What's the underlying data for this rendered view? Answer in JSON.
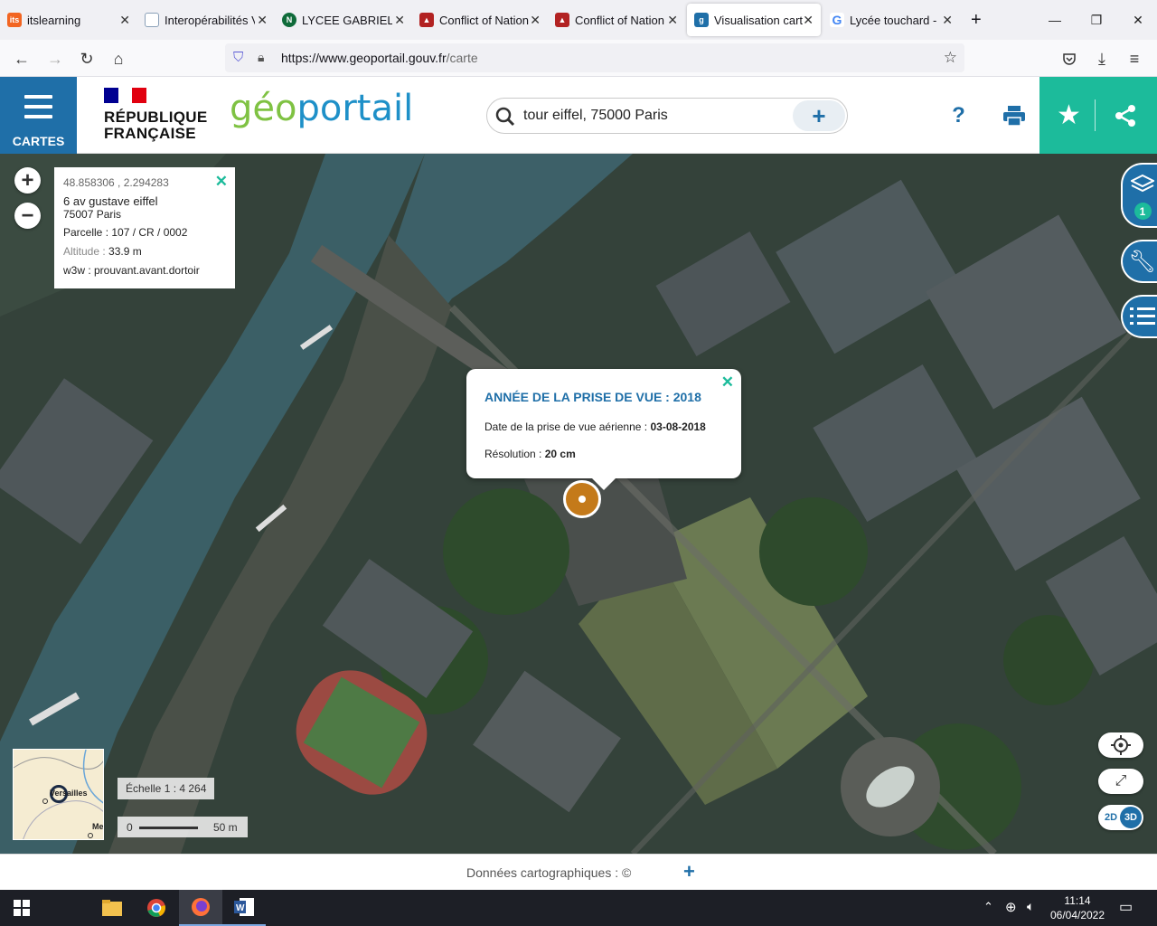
{
  "browser": {
    "tabs": [
      {
        "title": "itslearning",
        "favicon": "itslearning-favicon",
        "color": "#f26522"
      },
      {
        "title": "Interopérabilités V",
        "favicon": "document-favicon",
        "color": "#8aa0b8"
      },
      {
        "title": "LYCEE GABRIEL TC",
        "favicon": "ngt-favicon",
        "color": "#0f6b3a"
      },
      {
        "title": "Conflict of Nation",
        "favicon": "conflict-favicon",
        "color": "#b22222"
      },
      {
        "title": "Conflict of Nation",
        "favicon": "conflict-favicon",
        "color": "#b22222"
      },
      {
        "title": "Visualisation carte",
        "favicon": "geoportail-favicon",
        "color": "#1f6fa8"
      },
      {
        "title": "Lycée touchard - F",
        "favicon": "google-favicon",
        "color": "#4285f4"
      }
    ],
    "new_tab": "+",
    "url_main": "https://www.geoportail.gouv.fr",
    "url_path": "/carte"
  },
  "header": {
    "menu_label": "CARTES",
    "republique_line1": "RÉPUBLIQUE",
    "republique_line2": "FRANÇAISE",
    "logo_geo": "géo",
    "logo_portail": "portail",
    "search_value": "tour eiffel, 75000 Paris",
    "search_plus": "+",
    "help_label": "?"
  },
  "colors": {
    "brand_blue": "#1f6fa8",
    "accent_green": "#1cbb9b",
    "marker_orange": "#c47a1a"
  },
  "infobox": {
    "coords": "48.858306 , 2.294283",
    "address1": "6 av gustave eiffel",
    "address2": "75007 Paris",
    "parcelle": "Parcelle : 107 / CR / 0002",
    "altitude_label": "Altitude :",
    "altitude_value": "33.9 m",
    "w3w": "w3w : prouvant.avant.dortoir"
  },
  "popup": {
    "title": "ANNÉE DE LA PRISE DE VUE : 2018",
    "date_label": "Date de la prise de vue aérienne :",
    "date_value": "03-08-2018",
    "resolution_label": "Résolution :",
    "resolution_value": "20 cm"
  },
  "map": {
    "layers_count": "1",
    "view_2d": "2D",
    "view_3d": "3D",
    "scale_text": "Échelle 1 : 4 264",
    "scale_start": "0",
    "scale_end": "50 m",
    "minimap_label": "Versailles",
    "minimap_label2": "Me"
  },
  "footer": {
    "credits": "Données cartographiques : ©",
    "plus": "+"
  },
  "taskbar": {
    "time": "11:14",
    "date": "06/04/2022"
  }
}
